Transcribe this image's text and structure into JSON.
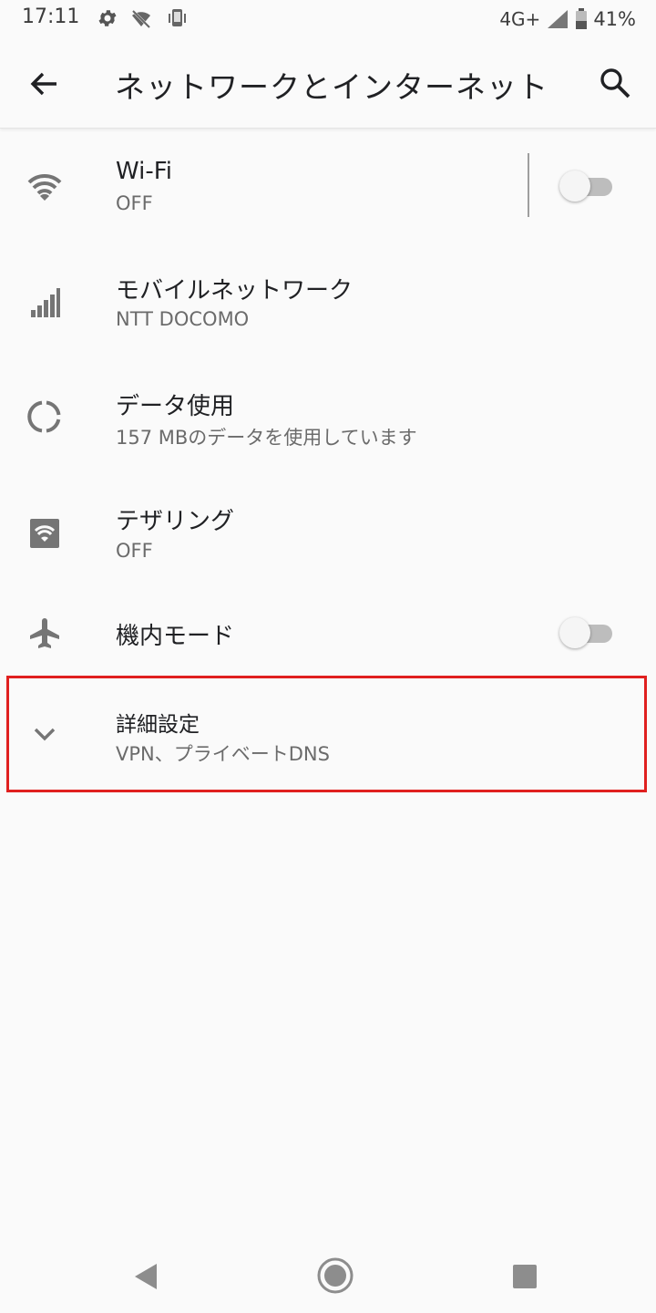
{
  "status_bar": {
    "time": "17:11",
    "network": "4G+",
    "battery": "41%",
    "icons": [
      "gear-icon",
      "no-wifi-icon",
      "phone-vibrate-icon",
      "signal-icon",
      "battery-icon"
    ]
  },
  "app_bar": {
    "title": "ネットワークとインターネット",
    "icons": [
      "back-arrow-icon",
      "search-icon"
    ]
  },
  "items": [
    {
      "label": "Wi-Fi",
      "sub": "OFF",
      "icon": "wifi-icon",
      "toggle": false
    },
    {
      "label": "モバイルネットワーク",
      "sub": "NTT DOCOMO",
      "icon": "cellular-signal-icon"
    },
    {
      "label": "データ使用",
      "sub": "157 MBのデータを使用しています",
      "icon": "data-usage-icon"
    },
    {
      "label": "テザリング",
      "sub": "OFF",
      "icon": "hotspot-icon"
    },
    {
      "label": "機内モード",
      "icon": "airplane-icon",
      "toggle": false
    },
    {
      "label": "詳細設定",
      "sub": "VPN、プライベートDNS",
      "icon": "chevron-down-icon",
      "highlighted": true
    }
  ],
  "colors": {
    "background": "#fafafa",
    "highlight": "#e0201f",
    "icon_gray": "#757575"
  },
  "nav_bar": {
    "icons": [
      "nav-back-icon",
      "nav-home-icon",
      "nav-recents-icon"
    ]
  }
}
